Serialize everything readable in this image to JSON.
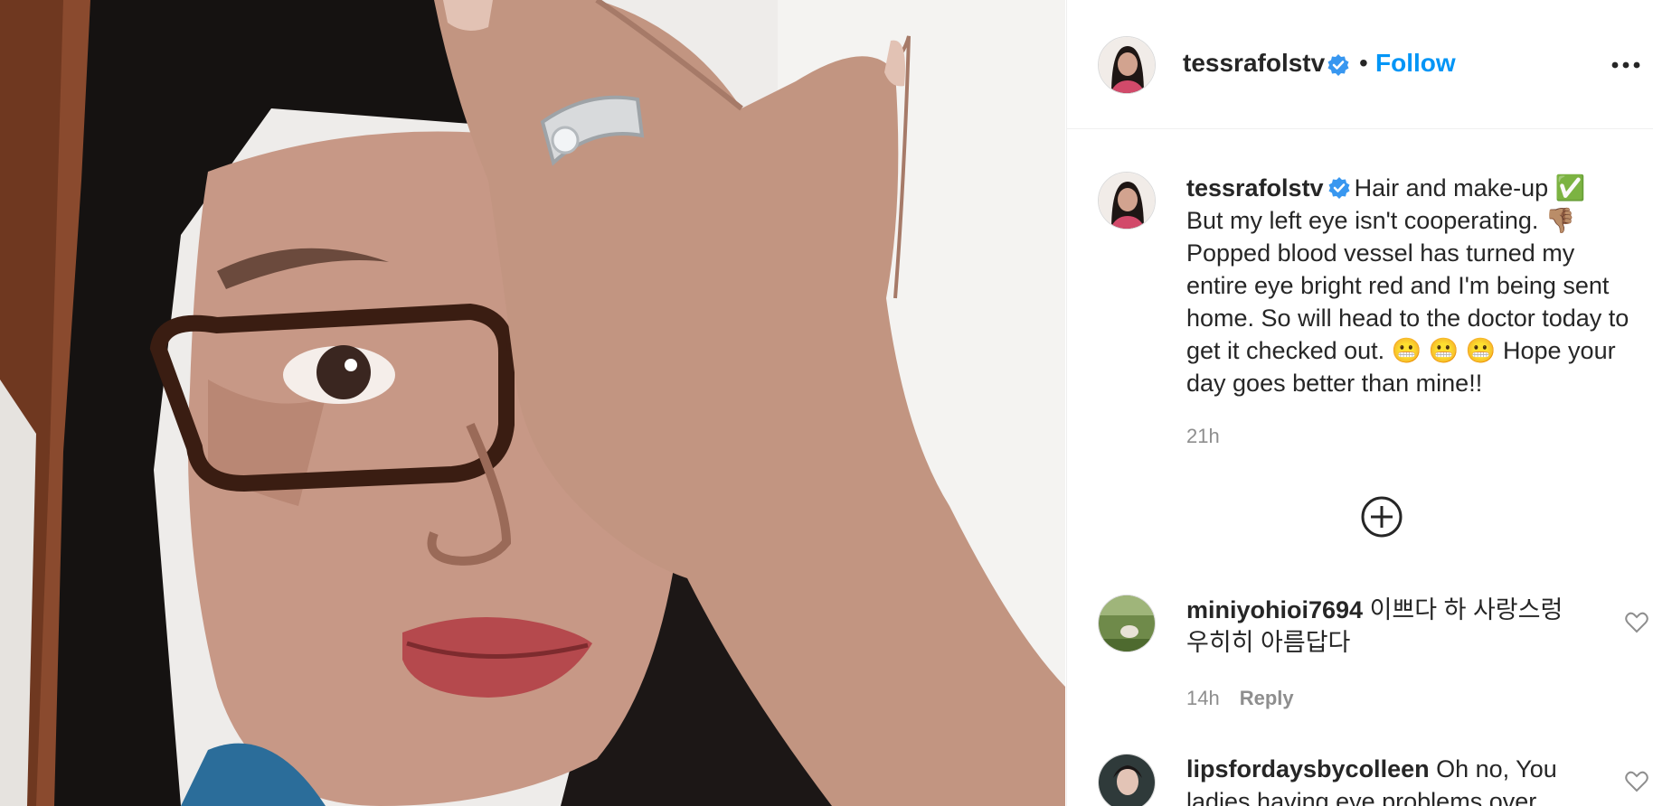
{
  "post": {
    "username": "tessrafolstv",
    "dot": "•",
    "follow_label": "Follow",
    "caption": {
      "username": "tessrafolstv",
      "text_line1": "Hair and make-up ✅",
      "text_rest": "But my left eye isn't cooperating. 👎🏽 Popped blood vessel has turned my entire eye bright red and I'm being sent home. So will head to the doctor today to get it checked out. 😬 😬 😬  Hope your day goes better than mine!!",
      "time": "21h"
    },
    "comments": [
      {
        "username": "miniyohioi7694",
        "text": "이쁘다 하 사랑스렁 우히히 아름답다",
        "time": "14h",
        "reply_label": "Reply"
      },
      {
        "username": "lipsfordaysbycolleen",
        "text": "Oh no, You ladies having eye problems over"
      }
    ]
  },
  "icons": {
    "verified": "verified-badge-icon",
    "more": "more-options-icon",
    "load_more": "load-more-comments-icon",
    "like": "heart-icon"
  },
  "colors": {
    "accent": "#0095f6",
    "verified": "#3897f0",
    "text": "#262626",
    "muted": "#8e8e8e",
    "border": "#efefef"
  }
}
